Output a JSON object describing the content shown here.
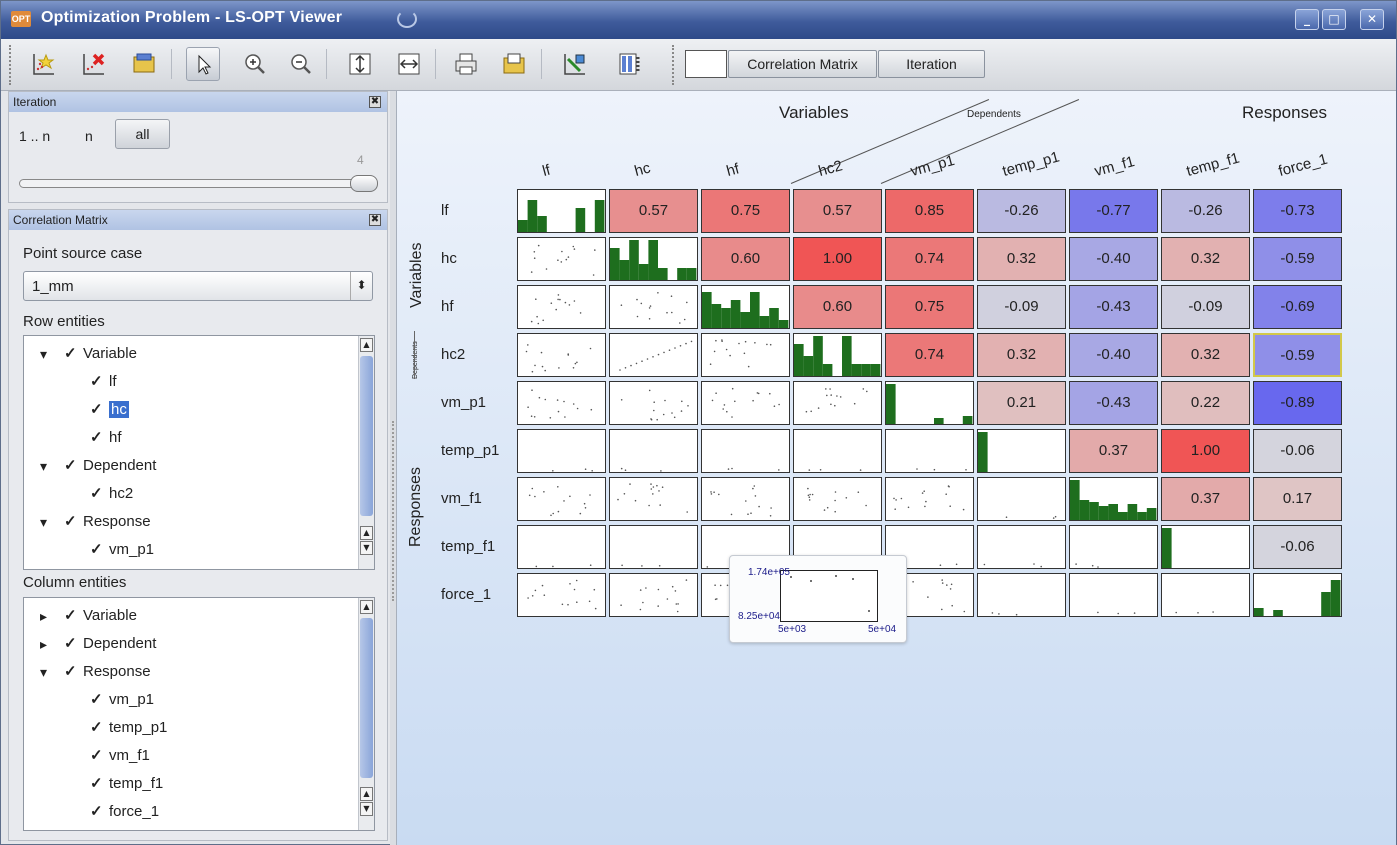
{
  "window": {
    "title": "Optimization Problem - LS-OPT Viewer",
    "app_icon": "OPT",
    "minimize": "_",
    "maximize": "□",
    "close": "✕"
  },
  "toolbar": {
    "icons": [
      "add-plot-icon",
      "delete-plot-icon",
      "open-folder-icon",
      "pointer-icon",
      "zoom-in-icon",
      "zoom-out-icon",
      "fit-vertical-icon",
      "fit-horizontal-icon",
      "print-icon",
      "export-icon",
      "chart-settings-icon",
      "table-columns-icon"
    ],
    "tab_correlation": "Correlation Matrix",
    "tab_iteration": "Iteration"
  },
  "iteration_panel": {
    "title": "Iteration",
    "close": "✖",
    "range_label": "1 .. n",
    "n_label": "n",
    "all_button": "all",
    "slider_max": "4",
    "slider_value": 4
  },
  "correlation_panel": {
    "title": "Correlation Matrix",
    "close": "✖",
    "point_source_label": "Point source case",
    "point_source_value": "1_mm",
    "combo_arrow": "⬍",
    "row_entities_label": "Row entities",
    "column_entities_label": "Column entities",
    "row_tree": [
      {
        "label": "Variable",
        "level": 0
      },
      {
        "label": "lf",
        "level": 1
      },
      {
        "label": "hc",
        "level": 1,
        "selected": true
      },
      {
        "label": "hf",
        "level": 1
      },
      {
        "label": "Dependent",
        "level": 0
      },
      {
        "label": "hc2",
        "level": 1
      },
      {
        "label": "Response",
        "level": 0
      },
      {
        "label": "vm_p1",
        "level": 1
      }
    ],
    "column_tree": [
      {
        "label": "Variable",
        "level": 0,
        "collapsed": true
      },
      {
        "label": "Dependent",
        "level": 0,
        "collapsed": true
      },
      {
        "label": "Response",
        "level": 0
      },
      {
        "label": "vm_p1",
        "level": 1
      },
      {
        "label": "temp_p1",
        "level": 1
      },
      {
        "label": "vm_f1",
        "level": 1
      },
      {
        "label": "temp_f1",
        "level": 1
      },
      {
        "label": "force_1",
        "level": 1
      }
    ]
  },
  "matrix": {
    "groups": {
      "variables": "Variables",
      "dependents": "Dependents",
      "responses": "Responses"
    },
    "columns": [
      "lf",
      "hc",
      "hf",
      "hc2",
      "vm_p1",
      "temp_p1",
      "vm_f1",
      "temp_f1",
      "force_1"
    ],
    "rows": [
      "lf",
      "hc",
      "hf",
      "hc2",
      "vm_p1",
      "temp_p1",
      "vm_f1",
      "temp_f1",
      "force_1"
    ],
    "row_group_labels": {
      "variables": "Variables",
      "dependents": "Dependents",
      "responses": "Responses"
    },
    "cells": [
      [
        null,
        "0.57",
        "0.75",
        "0.57",
        "0.85",
        "-0.26",
        "-0.77",
        "-0.26",
        "-0.73"
      ],
      [
        null,
        null,
        "0.60",
        "1.00",
        "0.74",
        "0.32",
        "-0.40",
        "0.32",
        "-0.59"
      ],
      [
        null,
        null,
        null,
        "0.60",
        "0.75",
        "-0.09",
        "-0.43",
        "-0.09",
        "-0.69"
      ],
      [
        null,
        null,
        null,
        null,
        "0.74",
        "0.32",
        "-0.40",
        "0.32",
        "-0.59"
      ],
      [
        null,
        null,
        null,
        null,
        null,
        "0.21",
        "-0.43",
        "0.22",
        "-0.89"
      ],
      [
        null,
        null,
        null,
        null,
        null,
        null,
        "0.37",
        "1.00",
        "-0.06"
      ],
      [
        null,
        null,
        null,
        null,
        null,
        null,
        null,
        "0.37",
        "0.17"
      ],
      [
        null,
        null,
        null,
        null,
        null,
        null,
        null,
        null,
        "-0.06"
      ],
      [
        null,
        null,
        null,
        null,
        null,
        null,
        null,
        null,
        null
      ]
    ],
    "highlighted_cell": {
      "row": "hc2",
      "column": "force_1"
    },
    "colors": {
      "positive": "#f05555",
      "negative": "#5a5af0",
      "neutral": "#dcdcdc",
      "histogram": "#1e6e1e"
    }
  },
  "tooltip": {
    "y_max": "1.74e+05",
    "y_min": "8.25e+04",
    "x_min": "5e+03",
    "x_max": "5e+04"
  }
}
